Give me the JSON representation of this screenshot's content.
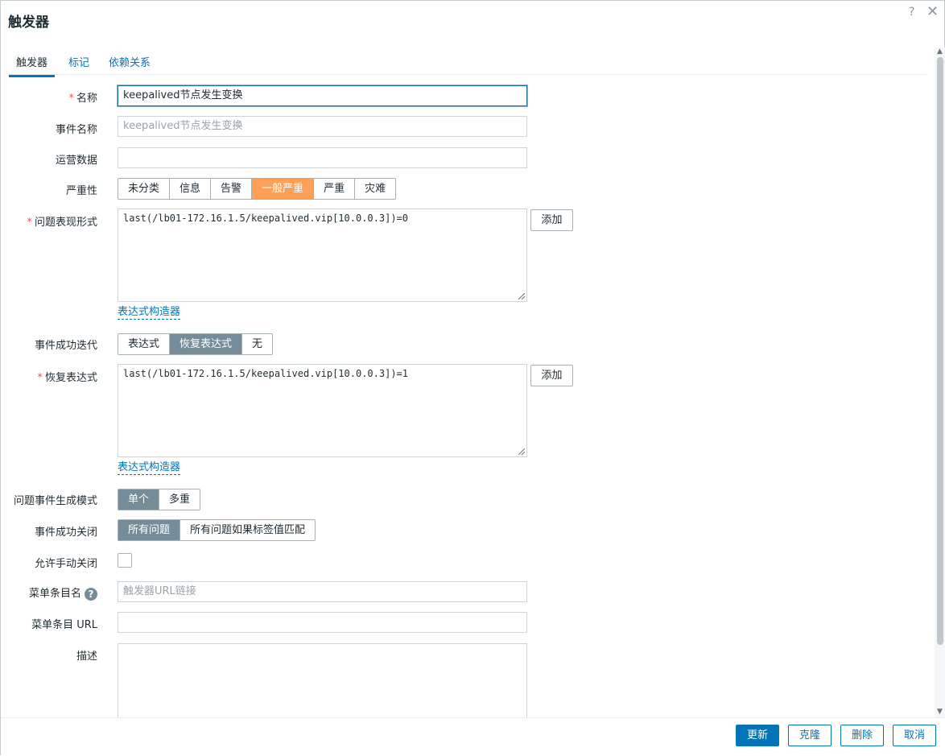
{
  "dialog": {
    "title": "触发器",
    "help_glyph": "?",
    "close_glyph": "✕"
  },
  "tabs": [
    {
      "label": "触发器",
      "active": true
    },
    {
      "label": "标记",
      "active": false
    },
    {
      "label": "依赖关系",
      "active": false
    }
  ],
  "form": {
    "name": {
      "label": "名称",
      "value": "keepalived节点发生变换"
    },
    "event_name": {
      "label": "事件名称",
      "placeholder": "keepalived节点发生变换"
    },
    "opdata": {
      "label": "运营数据",
      "value": ""
    },
    "severity": {
      "label": "严重性",
      "options": [
        "未分类",
        "信息",
        "告警",
        "一般严重",
        "严重",
        "灾难"
      ],
      "selected": "一般严重"
    },
    "problem_expression": {
      "label": "问题表现形式",
      "value": "last(/lb01-172.16.1.5/keepalived.vip[10.0.0.3])=0",
      "add_label": "添加",
      "builder_label": "表达式构造器"
    },
    "ok_event_generation": {
      "label": "事件成功迭代",
      "options": [
        "表达式",
        "恢复表达式",
        "无"
      ],
      "selected": "恢复表达式"
    },
    "recovery_expression": {
      "label": "恢复表达式",
      "value": "last(/lb01-172.16.1.5/keepalived.vip[10.0.0.3])=1",
      "add_label": "添加",
      "builder_label": "表达式构造器"
    },
    "problem_mode": {
      "label": "问题事件生成模式",
      "options": [
        "单个",
        "多重"
      ],
      "selected": "单个"
    },
    "ok_closes": {
      "label": "事件成功关闭",
      "options": [
        "所有问题",
        "所有问题如果标签值匹配"
      ],
      "selected": "所有问题"
    },
    "manual_close": {
      "label": "允许手动关闭",
      "checked": false
    },
    "url_name": {
      "label": "菜单条目名",
      "placeholder": "触发器URL链接",
      "help_glyph": "?"
    },
    "url": {
      "label": "菜单条目 URL",
      "value": ""
    },
    "description": {
      "label": "描述",
      "value": ""
    }
  },
  "footer": {
    "update": "更新",
    "clone": "克隆",
    "delete": "删除",
    "cancel": "取消"
  },
  "colors": {
    "accent": "#0275b8",
    "selected_segment": "#768d99",
    "severity_average": "#ffa059",
    "required": "#e45959"
  }
}
